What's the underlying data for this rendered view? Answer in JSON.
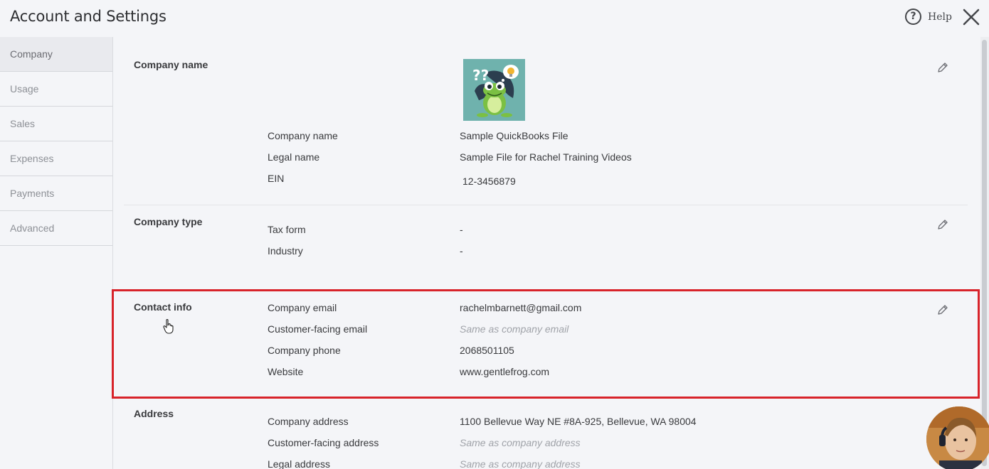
{
  "header": {
    "title": "Account and Settings",
    "help_label": "Help"
  },
  "sidebar": {
    "items": [
      {
        "label": "Company"
      },
      {
        "label": "Usage"
      },
      {
        "label": "Sales"
      },
      {
        "label": "Expenses"
      },
      {
        "label": "Payments"
      },
      {
        "label": "Advanced"
      }
    ]
  },
  "company_name": {
    "label": "Company name",
    "fields": [
      {
        "name": "Company name",
        "value": "Sample QuickBooks File"
      },
      {
        "name": "Legal name",
        "value": "Sample File for Rachel Training Videos"
      },
      {
        "name": "EIN",
        "value": "12-3456879"
      }
    ]
  },
  "company_type": {
    "label": "Company type",
    "fields": [
      {
        "name": "Tax form",
        "value": "-"
      },
      {
        "name": "Industry",
        "value": "-"
      }
    ]
  },
  "contact_info": {
    "label": "Contact info",
    "fields": [
      {
        "name": "Company email",
        "value": "rachelmbarnett@gmail.com"
      },
      {
        "name": "Customer-facing email",
        "value": "Same as company email"
      },
      {
        "name": "Company phone",
        "value": "2068501105"
      },
      {
        "name": "Website",
        "value": "www.gentlefrog.com"
      }
    ]
  },
  "address": {
    "label": "Address",
    "fields": [
      {
        "name": "Company address",
        "value": "1100 Bellevue Way NE #8A-925, Bellevue, WA 98004"
      },
      {
        "name": "Customer-facing address",
        "value": "Same as company address"
      },
      {
        "name": "Legal address",
        "value": "Same as company address"
      }
    ]
  },
  "colors": {
    "highlight": "#d8232a",
    "logo_bg": "#6fb2ad"
  }
}
